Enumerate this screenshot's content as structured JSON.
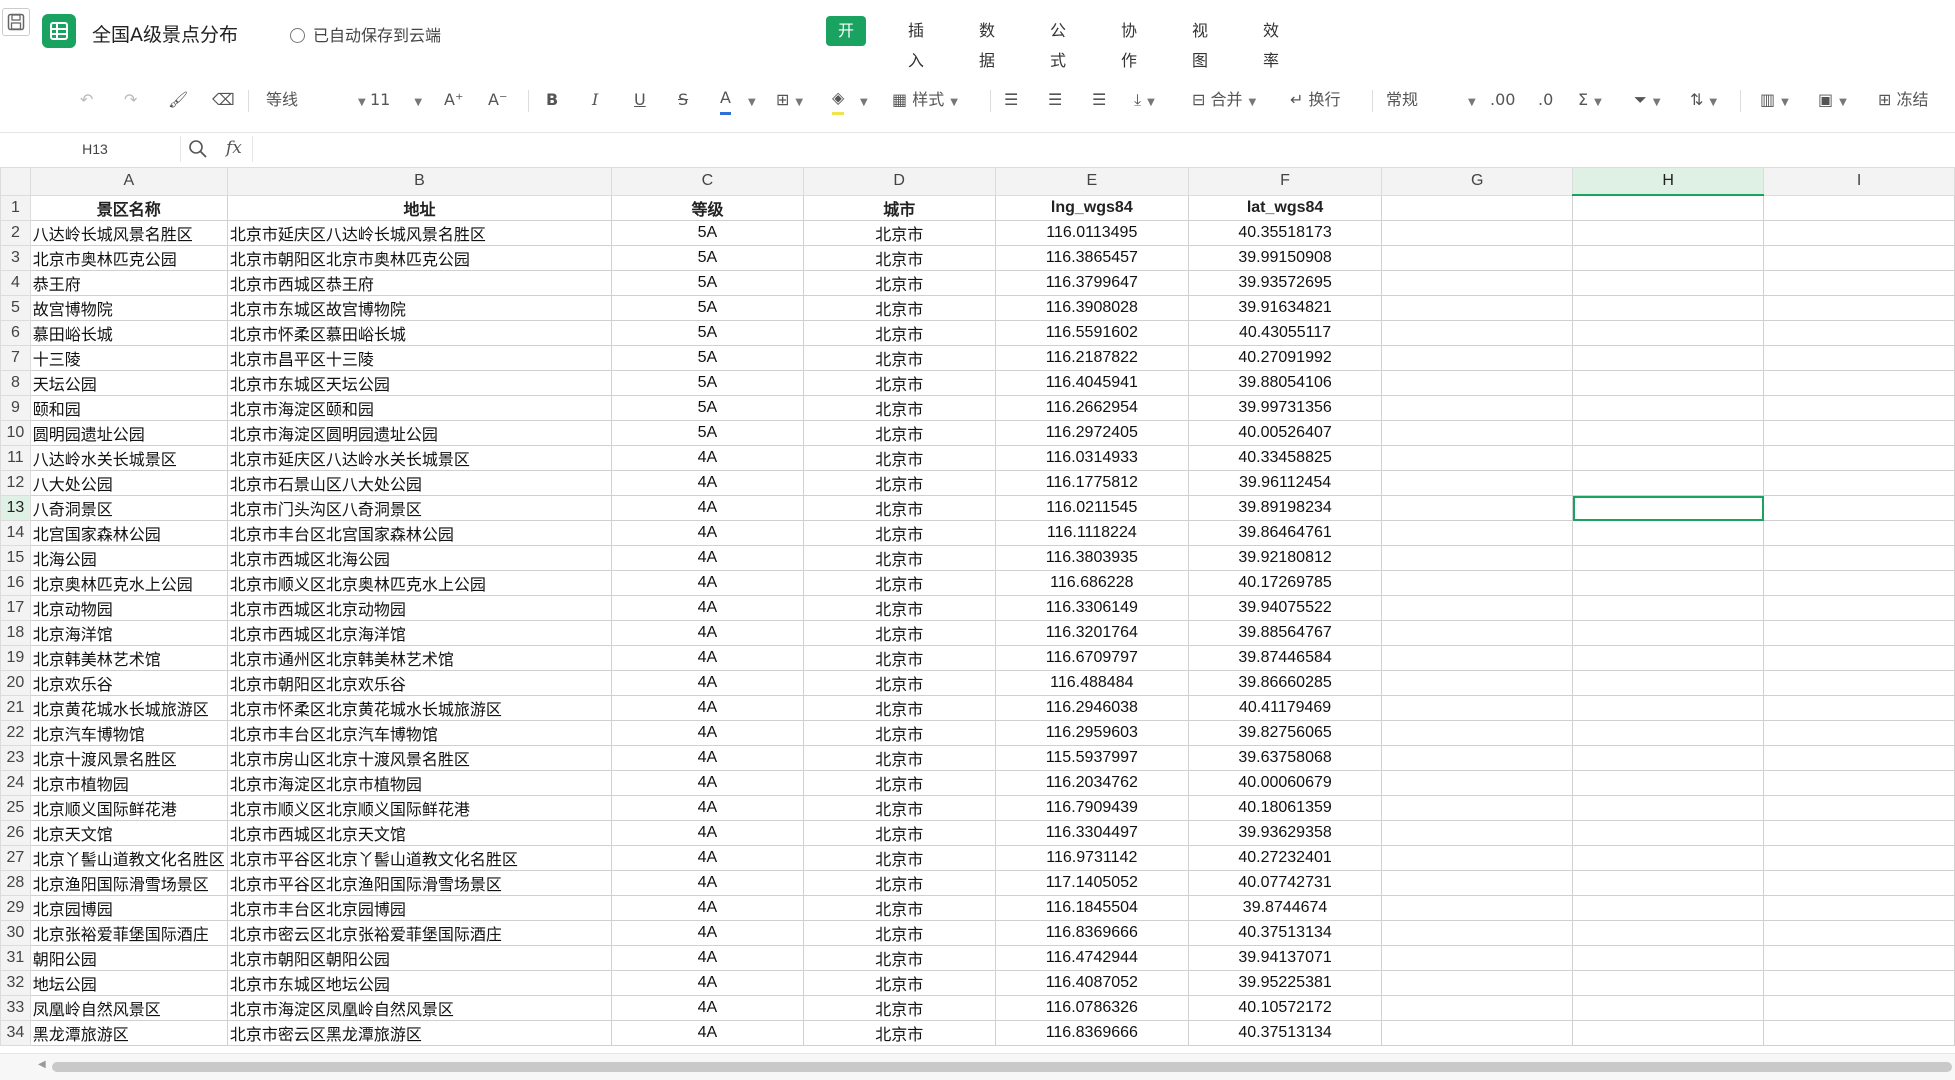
{
  "app": {
    "doc_title": "全国A级景点分布",
    "autosave": "已自动保存到云端"
  },
  "menu": [
    {
      "label": "开始",
      "active": true
    },
    {
      "label": "插入",
      "active": false
    },
    {
      "label": "数据",
      "active": false
    },
    {
      "label": "公式",
      "active": false
    },
    {
      "label": "协作",
      "active": false
    },
    {
      "label": "视图",
      "active": false
    },
    {
      "label": "效率",
      "active": false
    }
  ],
  "toolbar": {
    "font_name": "等线",
    "font_size": "11",
    "style_label": "样式",
    "merge_label": "合并",
    "wrap_label": "换行",
    "number_format": "常规",
    "freeze_label": "冻结"
  },
  "formula_bar": {
    "cell_ref": "H13",
    "fx": "fx",
    "value": ""
  },
  "grid": {
    "columns": [
      "A",
      "B",
      "C",
      "D",
      "E",
      "F",
      "G",
      "H",
      "I"
    ],
    "selected_column": "H",
    "selected_row": 13,
    "header_row": [
      "景区名称",
      "地址",
      "等级",
      "城市",
      "lng_wgs84",
      "lat_wgs84"
    ],
    "rows": [
      [
        "八达岭长城风景名胜区",
        "北京市延庆区八达岭长城风景名胜区",
        "5A",
        "北京市",
        "116.0113495",
        "40.35518173"
      ],
      [
        "北京市奥林匹克公园",
        "北京市朝阳区北京市奥林匹克公园",
        "5A",
        "北京市",
        "116.3865457",
        "39.99150908"
      ],
      [
        "恭王府",
        "北京市西城区恭王府",
        "5A",
        "北京市",
        "116.3799647",
        "39.93572695"
      ],
      [
        "故宫博物院",
        "北京市东城区故宫博物院",
        "5A",
        "北京市",
        "116.3908028",
        "39.91634821"
      ],
      [
        "慕田峪长城",
        "北京市怀柔区慕田峪长城",
        "5A",
        "北京市",
        "116.5591602",
        "40.43055117"
      ],
      [
        "十三陵",
        "北京市昌平区十三陵",
        "5A",
        "北京市",
        "116.2187822",
        "40.27091992"
      ],
      [
        "天坛公园",
        "北京市东城区天坛公园",
        "5A",
        "北京市",
        "116.4045941",
        "39.88054106"
      ],
      [
        "颐和园",
        "北京市海淀区颐和园",
        "5A",
        "北京市",
        "116.2662954",
        "39.99731356"
      ],
      [
        "圆明园遗址公园",
        "北京市海淀区圆明园遗址公园",
        "5A",
        "北京市",
        "116.2972405",
        "40.00526407"
      ],
      [
        "八达岭水关长城景区",
        "北京市延庆区八达岭水关长城景区",
        "4A",
        "北京市",
        "116.0314933",
        "40.33458825"
      ],
      [
        "八大处公园",
        "北京市石景山区八大处公园",
        "4A",
        "北京市",
        "116.1775812",
        "39.96112454"
      ],
      [
        "八奇洞景区",
        "北京市门头沟区八奇洞景区",
        "4A",
        "北京市",
        "116.0211545",
        "39.89198234"
      ],
      [
        "北宫国家森林公园",
        "北京市丰台区北宫国家森林公园",
        "4A",
        "北京市",
        "116.1118224",
        "39.86464761"
      ],
      [
        "北海公园",
        "北京市西城区北海公园",
        "4A",
        "北京市",
        "116.3803935",
        "39.92180812"
      ],
      [
        "北京奥林匹克水上公园",
        "北京市顺义区北京奥林匹克水上公园",
        "4A",
        "北京市",
        "116.686228",
        "40.17269785"
      ],
      [
        "北京动物园",
        "北京市西城区北京动物园",
        "4A",
        "北京市",
        "116.3306149",
        "39.94075522"
      ],
      [
        "北京海洋馆",
        "北京市西城区北京海洋馆",
        "4A",
        "北京市",
        "116.3201764",
        "39.88564767"
      ],
      [
        "北京韩美林艺术馆",
        "北京市通州区北京韩美林艺术馆",
        "4A",
        "北京市",
        "116.6709797",
        "39.87446584"
      ],
      [
        "北京欢乐谷",
        "北京市朝阳区北京欢乐谷",
        "4A",
        "北京市",
        "116.488484",
        "39.86660285"
      ],
      [
        "北京黄花城水长城旅游区",
        "北京市怀柔区北京黄花城水长城旅游区",
        "4A",
        "北京市",
        "116.2946038",
        "40.41179469"
      ],
      [
        "北京汽车博物馆",
        "北京市丰台区北京汽车博物馆",
        "4A",
        "北京市",
        "116.2959603",
        "39.82756065"
      ],
      [
        "北京十渡风景名胜区",
        "北京市房山区北京十渡风景名胜区",
        "4A",
        "北京市",
        "115.5937997",
        "39.63758068"
      ],
      [
        "北京市植物园",
        "北京市海淀区北京市植物园",
        "4A",
        "北京市",
        "116.2034762",
        "40.00060679"
      ],
      [
        "北京顺义国际鲜花港",
        "北京市顺义区北京顺义国际鲜花港",
        "4A",
        "北京市",
        "116.7909439",
        "40.18061359"
      ],
      [
        "北京天文馆",
        "北京市西城区北京天文馆",
        "4A",
        "北京市",
        "116.3304497",
        "39.93629358"
      ],
      [
        "北京丫髻山道教文化名胜区",
        "北京市平谷区北京丫髻山道教文化名胜区",
        "4A",
        "北京市",
        "116.9731142",
        "40.27232401"
      ],
      [
        "北京渔阳国际滑雪场景区",
        "北京市平谷区北京渔阳国际滑雪场景区",
        "4A",
        "北京市",
        "117.1405052",
        "40.07742731"
      ],
      [
        "北京园博园",
        "北京市丰台区北京园博园",
        "4A",
        "北京市",
        "116.1845504",
        "39.8744674"
      ],
      [
        "北京张裕爱菲堡国际酒庄",
        "北京市密云区北京张裕爱菲堡国际酒庄",
        "4A",
        "北京市",
        "116.8369666",
        "40.37513134"
      ],
      [
        "朝阳公园",
        "北京市朝阳区朝阳公园",
        "4A",
        "北京市",
        "116.4742944",
        "39.94137071"
      ],
      [
        "地坛公园",
        "北京市东城区地坛公园",
        "4A",
        "北京市",
        "116.4087052",
        "39.95225381"
      ],
      [
        "凤凰岭自然风景区",
        "北京市海淀区凤凰岭自然风景区",
        "4A",
        "北京市",
        "116.0786326",
        "40.10572172"
      ],
      [
        "黑龙潭旅游区",
        "北京市密云区黑龙潭旅游区",
        "4A",
        "北京市",
        "116.8369666",
        "40.37513134"
      ]
    ]
  }
}
